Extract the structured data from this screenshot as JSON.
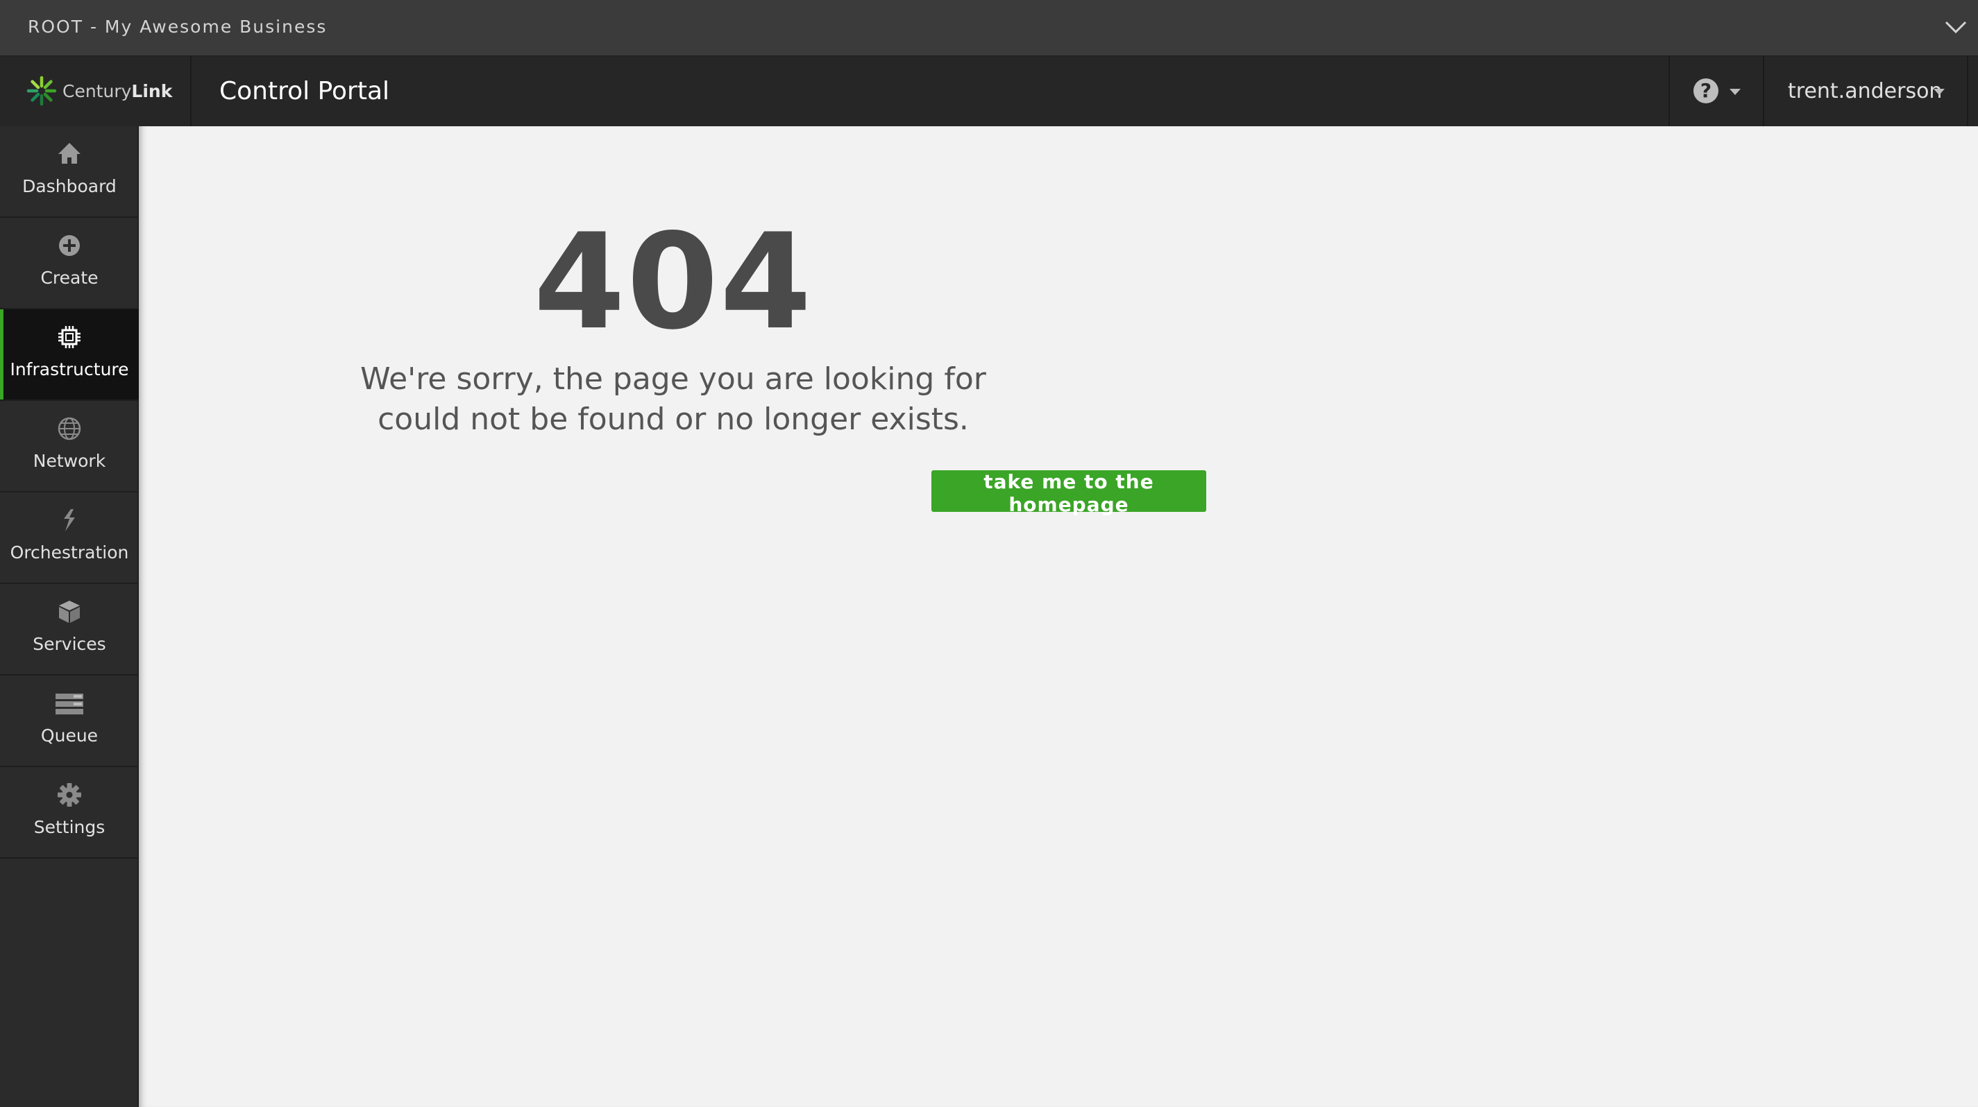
{
  "account_bar": {
    "title": "ROOT - My Awesome Business",
    "expand_icon": "chevron-down-icon"
  },
  "header": {
    "logo": {
      "brand_light": "Century",
      "brand_bold": "Link",
      "icon": "centurylink-logo-icon"
    },
    "title": "Control Portal",
    "help": {
      "icon": "question-circle-icon",
      "caret": "caret-down-icon"
    },
    "user": {
      "name": "trent.anderson",
      "caret": "caret-down-icon"
    }
  },
  "sidebar": {
    "active_index": 2,
    "items": [
      {
        "label": "Dashboard",
        "icon": "home-icon"
      },
      {
        "label": "Create",
        "icon": "plus-circle-icon"
      },
      {
        "label": "Infrastructure",
        "icon": "cpu-chip-icon"
      },
      {
        "label": "Network",
        "icon": "globe-icon"
      },
      {
        "label": "Orchestration",
        "icon": "orchestration-icon"
      },
      {
        "label": "Services",
        "icon": "cube-icon"
      },
      {
        "label": "Queue",
        "icon": "queue-icon"
      },
      {
        "label": "Settings",
        "icon": "gear-icon"
      }
    ]
  },
  "main": {
    "error_code": "404",
    "message": "We're sorry, the page you are looking for could not be found or no longer exists.",
    "button_label": "take me to the homepage"
  },
  "colors": {
    "accent": "#3aa526",
    "account_bar_bg": "#3b3b3b",
    "header_bg": "#262626",
    "sidebar_bg": "#2b2b2b",
    "content_bg": "#f2f2f2"
  }
}
